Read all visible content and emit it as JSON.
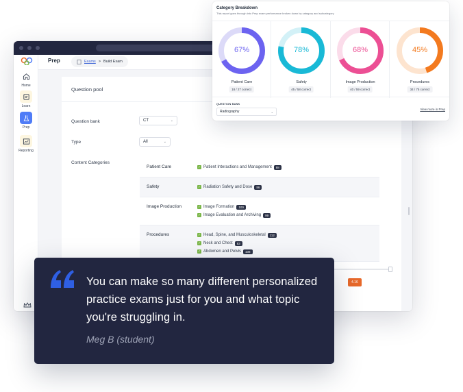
{
  "app": {
    "page_title": "Prep",
    "breadcrumb": {
      "link": "Exams",
      "separator": ">",
      "current": "Build Exam"
    },
    "sidebar": [
      {
        "label": "Home",
        "icon": "home-icon"
      },
      {
        "label": "Learn",
        "icon": "book-icon"
      },
      {
        "label": "Prep",
        "icon": "flask-icon",
        "active": true
      },
      {
        "label": "Reporting",
        "icon": "chart-icon"
      }
    ],
    "panel": {
      "title": "Question pool",
      "question_bank_label": "Question bank",
      "question_bank_value": "CT",
      "type_label": "Type",
      "type_value": "All",
      "content_categories_label": "Content Categories"
    },
    "categories": [
      {
        "name": "Patient Care",
        "items": [
          {
            "label": "Patient Interactions and Management",
            "count": "88"
          }
        ]
      },
      {
        "name": "Safety",
        "items": [
          {
            "label": "Radiation Safety and Dose",
            "count": "86"
          }
        ]
      },
      {
        "name": "Image Production",
        "items": [
          {
            "label": "Image Formation",
            "count": "100"
          },
          {
            "label": "Image Evaluation and Archiving",
            "count": "99"
          }
        ]
      },
      {
        "name": "Procedures",
        "items": [
          {
            "label": "Head, Spine, and Musculoskeletal",
            "count": "112"
          },
          {
            "label": "Neck and Chest",
            "count": "83"
          },
          {
            "label": "Abdomen and Pelvis",
            "count": "108"
          }
        ]
      }
    ],
    "badge": "4.16",
    "colors": {
      "accent": "#4f7cf7",
      "titlebar": "#22263f",
      "check": "#7ab648",
      "badge": "#e8692a"
    }
  },
  "card": {
    "title": "Category Breakdown",
    "subtitle": "This report goes through into Prep exam performance broken down by category and subcategory",
    "question_bank_label": "QUESTION BANK",
    "question_bank_value": "Radiography",
    "view_more": "View more in Prep",
    "rings": [
      {
        "name": "Patient Care",
        "percent": 67,
        "label": "67%",
        "count": "18 / 27 correct",
        "color": "#6c63f0",
        "track": "#dcdaf8"
      },
      {
        "name": "Safety",
        "percent": 78,
        "label": "78%",
        "count": "45 / 58 correct",
        "color": "#19b9d6",
        "track": "#d3f1f7"
      },
      {
        "name": "Image Production",
        "percent": 68,
        "label": "68%",
        "count": "40 / 59 correct",
        "color": "#ec4f94",
        "track": "#fbdcea"
      },
      {
        "name": "Procedures",
        "percent": 45,
        "label": "45%",
        "count": "34 / 75 correct",
        "color": "#f37a1f",
        "track": "#fde4cf"
      }
    ]
  },
  "testimonial": {
    "quote": "You can make so many different personalized practice exams just for you and what topic you're struggling in.",
    "author": "Meg B (student)",
    "mark_color": "#2f5fe3"
  }
}
